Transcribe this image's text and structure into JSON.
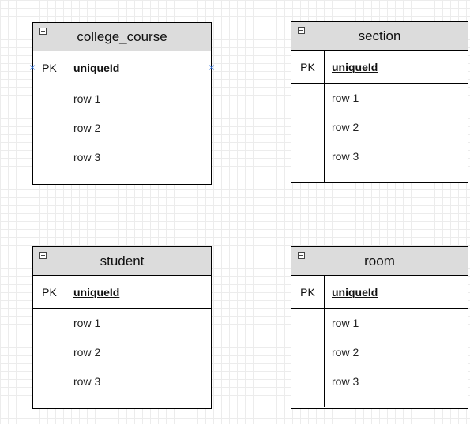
{
  "entities": [
    {
      "title": "college_course",
      "pk_label": "PK",
      "pk_field": "uniqueId",
      "rows": [
        "row 1",
        "row 2",
        "row 3"
      ]
    },
    {
      "title": "section",
      "pk_label": "PK",
      "pk_field": "uniqueId",
      "rows": [
        "row 1",
        "row 2",
        "row 3"
      ]
    },
    {
      "title": "student",
      "pk_label": "PK",
      "pk_field": "uniqueId",
      "rows": [
        "row 1",
        "row 2",
        "row 3"
      ]
    },
    {
      "title": "room",
      "pk_label": "PK",
      "pk_field": "uniqueId",
      "rows": [
        "row 1",
        "row 2",
        "row 3"
      ]
    }
  ],
  "colors": {
    "header_fill": "#dcdcdc",
    "border": "#000000",
    "connection_marker": "#2a6fdb",
    "grid": "#ececec"
  }
}
